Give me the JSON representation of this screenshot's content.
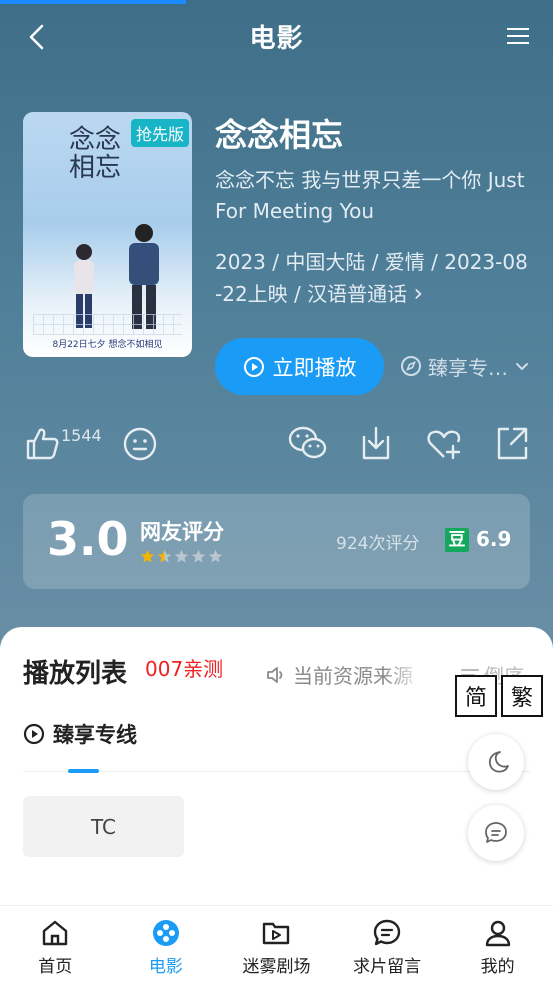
{
  "header": {
    "title": "电影"
  },
  "movie": {
    "poster_title": "念念\n相忘",
    "poster_badge": "抢先版",
    "poster_footer": "8月22日七夕  想念不如相见",
    "title": "念念相忘",
    "subtitle": "念念不忘 我与世界只差一个你 Just For Meeting You",
    "meta": "2023 / 中国大陆 / 爱情 / 2023-08-22上映 / 汉语普通话",
    "meta_chevron": "›",
    "play_label": "立即播放",
    "source_label": "臻享专…"
  },
  "actions": {
    "like_count": "1544"
  },
  "rating": {
    "score": "3.0",
    "label": "网友评分",
    "stars_value": 1.5,
    "stars_max": 5,
    "count": "924次评分",
    "douban_badge": "豆",
    "douban_score": "6.9"
  },
  "playlist": {
    "title": "播放列表",
    "tag": "007亲测",
    "source_text": "当前资源来源",
    "order_label": "倒序",
    "line_label": "臻享专线",
    "episodes": [
      "TC"
    ]
  },
  "script_toggle": {
    "simplified": "简",
    "traditional": "繁"
  },
  "tabbar": {
    "items": [
      {
        "label": "首页",
        "icon": "home-icon"
      },
      {
        "label": "电影",
        "icon": "film-reel-icon"
      },
      {
        "label": "迷雾剧场",
        "icon": "folder-play-icon"
      },
      {
        "label": "求片留言",
        "icon": "message-icon"
      },
      {
        "label": "我的",
        "icon": "user-icon"
      }
    ],
    "active_index": 1
  },
  "colors": {
    "accent": "#1a9bf5",
    "header_bg": "#4a7a93",
    "tag_red": "#e22222",
    "douban_green": "#13a85e"
  }
}
